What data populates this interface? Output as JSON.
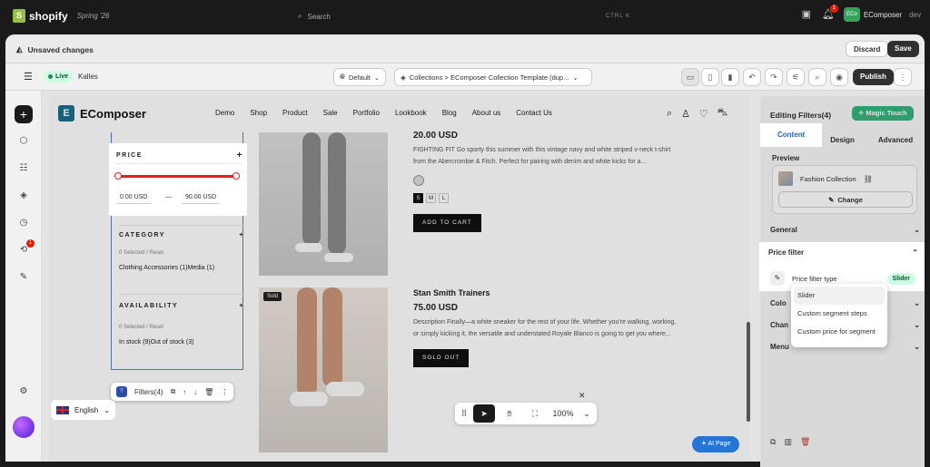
{
  "topbar": {
    "logo_text": "shopify",
    "edition": "Spring '26",
    "search_placeholder": "Search",
    "shortcut": "CTRL  K",
    "notification_count": "1",
    "user_initials": "ECo",
    "user_name": "EComposer",
    "user_role": "dev"
  },
  "unsaved": {
    "label": "Unsaved changes",
    "discard": "Discard",
    "save": "Save"
  },
  "toolbar": {
    "live": "Live",
    "theme": "Kalles",
    "lang": "Default",
    "template": "Collections > EComposer Collection Template (dup...",
    "publish": "Publish"
  },
  "rail": {
    "history_badge": "1"
  },
  "store": {
    "brand": "EComposer",
    "menu": [
      "Demo",
      "Shop",
      "Product",
      "Sale",
      "Portfolio",
      "Lookbook",
      "Blog",
      "About us",
      "Contact Us"
    ]
  },
  "filters": {
    "price_title": "PRICE",
    "min": "0.00 USD",
    "dash": "—",
    "max": "90.00 USD",
    "category_title": "CATEGORY",
    "selected": "0 Selected",
    "reset": "Reset",
    "category_items": "Clothing Accessories (1)Media (1)",
    "availability_title": "AVAILABILITY",
    "availability_items": "In stock (9)Out of stock (3)",
    "toolbar_label": "Filters(4)"
  },
  "products": [
    {
      "price": "20.00 USD",
      "desc": "FIGHTING FIT Go sporty this summer with this vintage navy and white striped v-neck t-shirt from the Abercrombie & Fitch. Perfect for pairing with denim and white kicks for a...",
      "sizes": [
        "S",
        "M",
        "L"
      ],
      "button": "ADD TO CART"
    },
    {
      "badge": "Sold",
      "title": "Stan Smith Trainers",
      "price": "75.00 USD",
      "desc": "Description Finally—a white sneaker for the rest of your life. Whether you're walking, working, or simply kicking it, the versatile and understated Royale Blanco is going to get you where...",
      "button": "SOLD OUT"
    }
  ],
  "canvas_tools": {
    "zoom": "100%",
    "language": "English",
    "ai": "AI Page"
  },
  "panel": {
    "title": "Editing Filters(4)",
    "magic": "Magic Touch",
    "tabs": [
      "Content",
      "Design",
      "Advanced"
    ],
    "preview_label": "Preview",
    "collection": "Fashion Collection",
    "change": "Change",
    "general": "General",
    "price_filter": "Price filter",
    "filter_type_label": "Price filter type",
    "filter_type_value": "Slider",
    "color_partial": "Colo",
    "change_partial": "Chan",
    "menu_partial": "Menu",
    "dropdown_options": [
      "Slider",
      "Custom segment steps",
      "Custom price for segment"
    ]
  }
}
